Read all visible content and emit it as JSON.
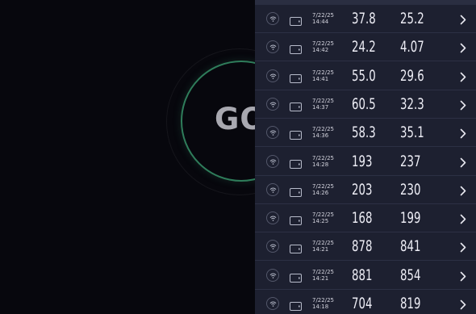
{
  "go_button": {
    "label": "GO"
  },
  "history": [
    {
      "date": "7/22/25",
      "time": "14:44",
      "download": "37.8",
      "upload": "25.2"
    },
    {
      "date": "7/22/25",
      "time": "14:42",
      "download": "24.2",
      "upload": "4.07"
    },
    {
      "date": "7/22/25",
      "time": "14:41",
      "download": "55.0",
      "upload": "29.6"
    },
    {
      "date": "7/22/25",
      "time": "14:37",
      "download": "60.5",
      "upload": "32.3"
    },
    {
      "date": "7/22/25",
      "time": "14:36",
      "download": "58.3",
      "upload": "35.1"
    },
    {
      "date": "7/22/25",
      "time": "14:28",
      "download": "193",
      "upload": "237"
    },
    {
      "date": "7/22/25",
      "time": "14:26",
      "download": "203",
      "upload": "230"
    },
    {
      "date": "7/22/25",
      "time": "14:25",
      "download": "168",
      "upload": "199"
    },
    {
      "date": "7/22/25",
      "time": "14:21",
      "download": "878",
      "upload": "841"
    },
    {
      "date": "7/22/25",
      "time": "14:21",
      "download": "881",
      "upload": "854"
    },
    {
      "date": "7/22/25",
      "time": "14:18",
      "download": "704",
      "upload": "819"
    }
  ],
  "icons": {
    "connection": "wifi-icon",
    "device": "tablet-icon",
    "open": "chevron-right-icon"
  },
  "colors": {
    "ring": "#2f7d5b",
    "panel": "#1d2030",
    "background": "#07070d"
  }
}
